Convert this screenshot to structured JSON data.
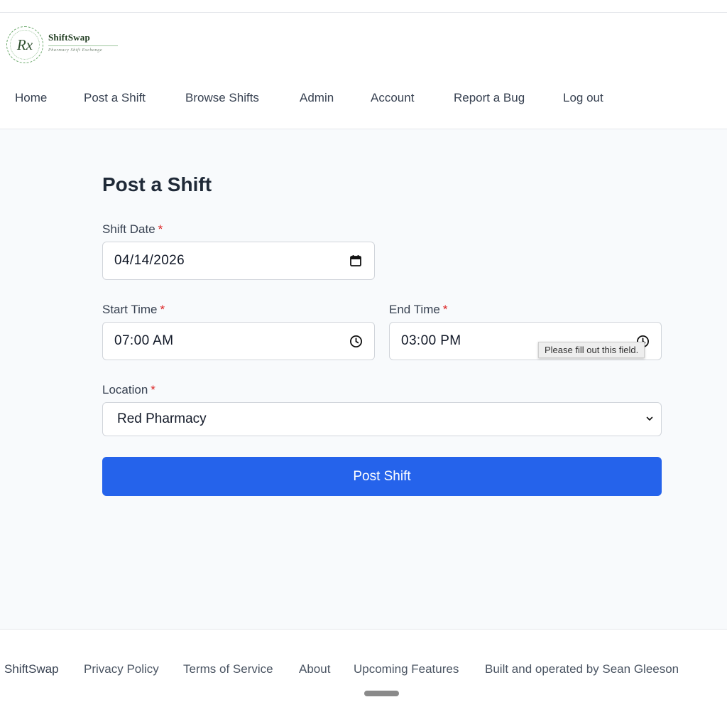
{
  "header": {
    "logo_mark": "Rx",
    "app_name": "ShiftSwap",
    "tagline": "Pharmacy Shift Exchange"
  },
  "nav": [
    {
      "label": "Home",
      "name": "nav-home"
    },
    {
      "label": "Post a Shift",
      "name": "nav-post-a-shift"
    },
    {
      "label": "Browse Shifts",
      "name": "nav-browse-shifts"
    },
    {
      "label": "Admin",
      "name": "nav-admin"
    },
    {
      "label": "Account",
      "name": "nav-account"
    },
    {
      "label": "Report a Bug",
      "name": "nav-report-a-bug"
    },
    {
      "label": "Log out",
      "name": "nav-log-out"
    }
  ],
  "form": {
    "title": "Post a Shift",
    "required_marker": "*",
    "shift_date": {
      "label": "Shift Date",
      "value": "04/14/2026",
      "icon": "calendar-icon"
    },
    "start_time": {
      "label": "Start Time",
      "value": "07:00 AM",
      "icon": "clock-icon"
    },
    "end_time": {
      "label": "End Time",
      "value": "03:00 PM",
      "icon": "clock-icon"
    },
    "validation_tooltip": "Please fill out this field.",
    "location": {
      "label": "Location",
      "value": "Red Pharmacy",
      "icon": "chevron-down-icon"
    },
    "submit_label": "Post Shift"
  },
  "footer": {
    "brand": "ShiftSwap",
    "links": [
      "Privacy Policy",
      "Terms of Service",
      "About",
      "Upcoming Features"
    ],
    "credit": "Built and operated by Sean Gleeson"
  },
  "colors": {
    "primary": "#2563eb",
    "required": "#dc2626",
    "main_bg": "#f8fafc",
    "logo_green": "#2f4f2f"
  }
}
